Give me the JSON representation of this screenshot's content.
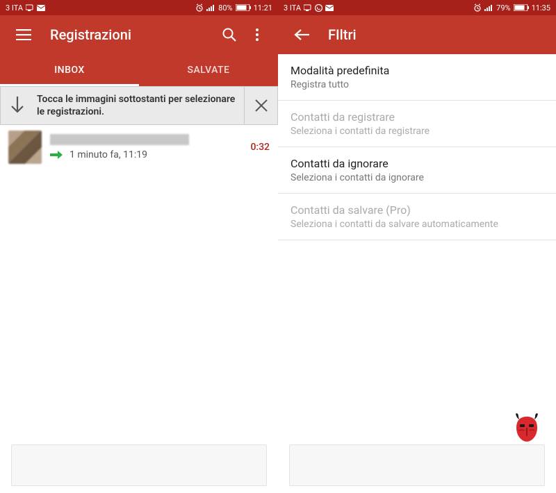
{
  "colors": {
    "primary": "#c0392b",
    "primary_dark": "#a72019",
    "duration": "#b0261f"
  },
  "left": {
    "status": {
      "carrier": "3 ITA",
      "battery": "80%",
      "time": "11:21"
    },
    "title": "Registrazioni",
    "tabs": {
      "inbox": "INBOX",
      "saved": "SALVATE"
    },
    "tip": "Tocca le immagini sottostanti per selezionare le registrazioni.",
    "recordings": [
      {
        "time_text": "1 minuto fa, 11:19",
        "duration": "0:32"
      }
    ]
  },
  "right": {
    "status": {
      "carrier": "3 ITA",
      "battery": "79%",
      "time": "11:35"
    },
    "title": "FIltri",
    "items": [
      {
        "title": "Modalità predefinita",
        "subtitle": "Registra tutto",
        "enabled": true
      },
      {
        "title": "Contatti da registrare",
        "subtitle": "Seleziona i contatti da registrare",
        "enabled": false
      },
      {
        "title": "Contatti da ignorare",
        "subtitle": "Seleziona i contatti da ignorare",
        "enabled": true
      },
      {
        "title": "Contatti da salvare (Pro)",
        "subtitle": "Seleziona i contatti da salvare automaticamente",
        "enabled": false
      }
    ]
  }
}
